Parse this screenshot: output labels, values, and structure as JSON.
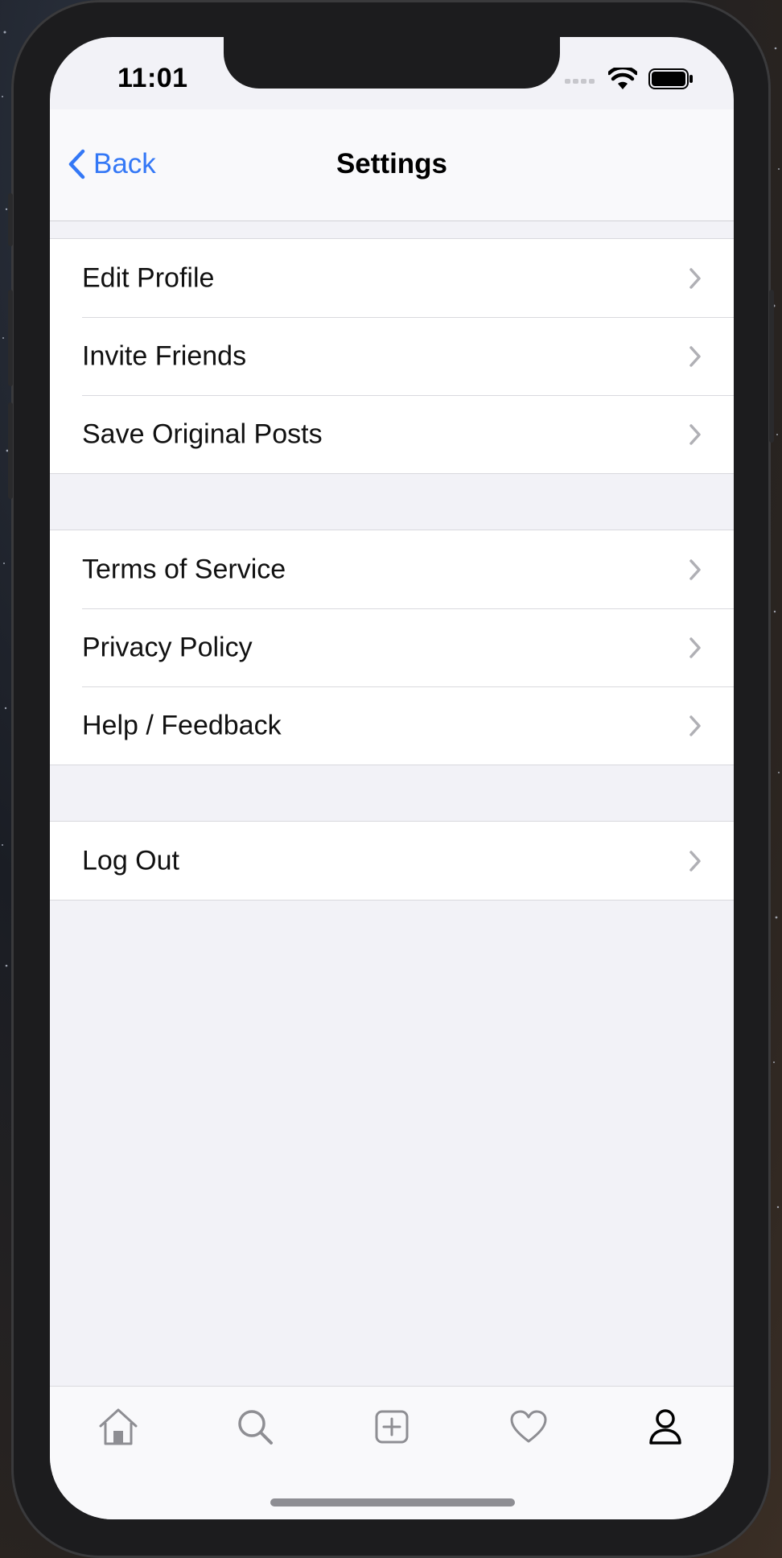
{
  "status_bar": {
    "time": "11:01"
  },
  "navbar": {
    "back_label": "Back",
    "title": "Settings"
  },
  "groups": [
    {
      "items": [
        {
          "label": "Edit Profile"
        },
        {
          "label": "Invite Friends"
        },
        {
          "label": "Save Original Posts"
        }
      ]
    },
    {
      "items": [
        {
          "label": "Terms of Service"
        },
        {
          "label": "Privacy Policy"
        },
        {
          "label": "Help / Feedback"
        }
      ]
    },
    {
      "items": [
        {
          "label": "Log Out"
        }
      ]
    }
  ],
  "tab_bar": {
    "tabs": [
      {
        "icon": "home-icon",
        "active": false
      },
      {
        "icon": "search-icon",
        "active": false
      },
      {
        "icon": "add-post-icon",
        "active": false
      },
      {
        "icon": "heart-icon",
        "active": false
      },
      {
        "icon": "profile-icon",
        "active": true
      }
    ]
  },
  "colors": {
    "accent": "#3478f6",
    "background": "#f2f2f7",
    "cell": "#ffffff",
    "separator": "#d9d9de",
    "chevron": "#b0b0b5",
    "inactive_tab": "#8e8e93",
    "active_tab": "#000000"
  }
}
